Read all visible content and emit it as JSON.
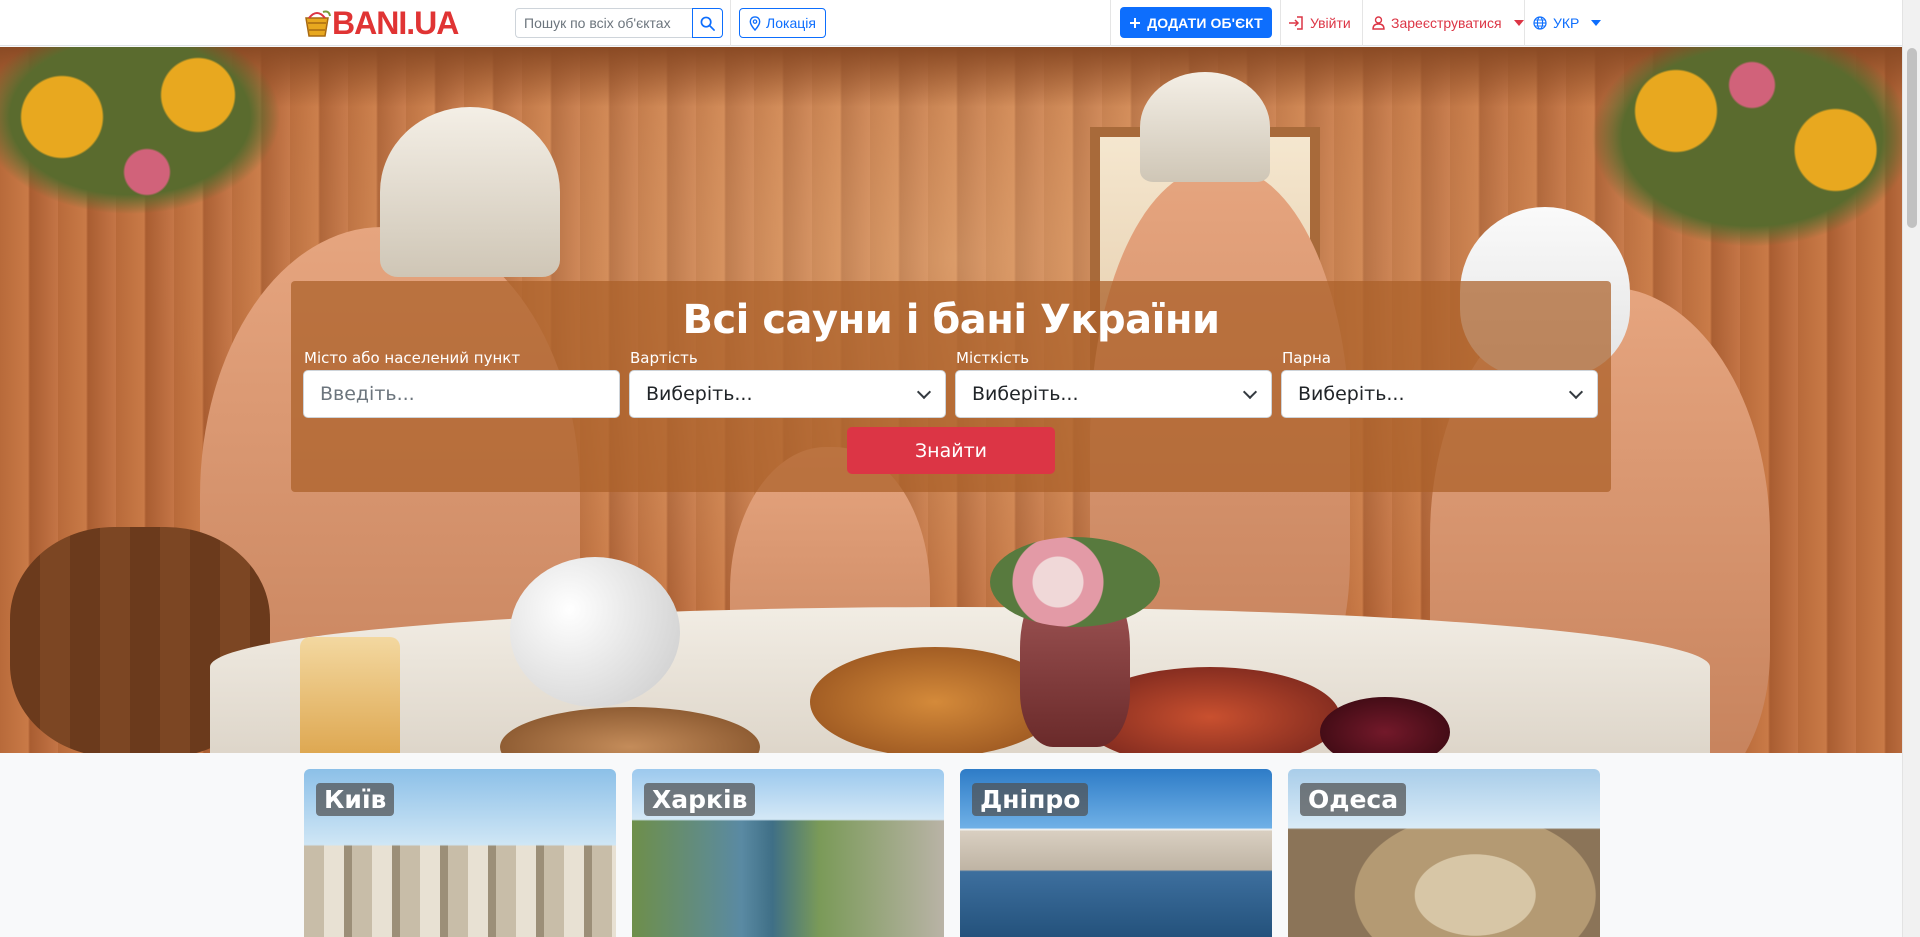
{
  "brand": {
    "logo_text": "BANI.UA",
    "accent_red": "#dc3545",
    "accent_blue": "#0d6efd",
    "logo_icon": "sauna-bucket-icon"
  },
  "header": {
    "search_placeholder": "Пошук по всіх об'єктах",
    "search_icon": "search-icon",
    "location_label": "Локація",
    "location_icon": "map-pin-icon",
    "add_object_label": "ДОДАТИ ОБ'ЄКТ",
    "add_icon": "plus-icon",
    "login_label": "Увійти",
    "login_icon": "sign-in-icon",
    "register_label": "Зареєструватися",
    "register_icon": "user-icon",
    "language_label": "УКР",
    "language_icon": "globe-icon"
  },
  "hero": {
    "title": "Всі сауни і бані України",
    "fields": [
      {
        "label": "Місто або населений пункт",
        "placeholder": "Введіть..."
      },
      {
        "label": "Вартість",
        "value": "Виберіть..."
      },
      {
        "label": "Місткість",
        "value": "Виберіть..."
      },
      {
        "label": "Парна",
        "value": "Виберіть..."
      }
    ],
    "submit_label": "Знайти"
  },
  "cities": [
    {
      "name": "Київ"
    },
    {
      "name": "Харків"
    },
    {
      "name": "Дніпро"
    },
    {
      "name": "Одеса"
    }
  ]
}
